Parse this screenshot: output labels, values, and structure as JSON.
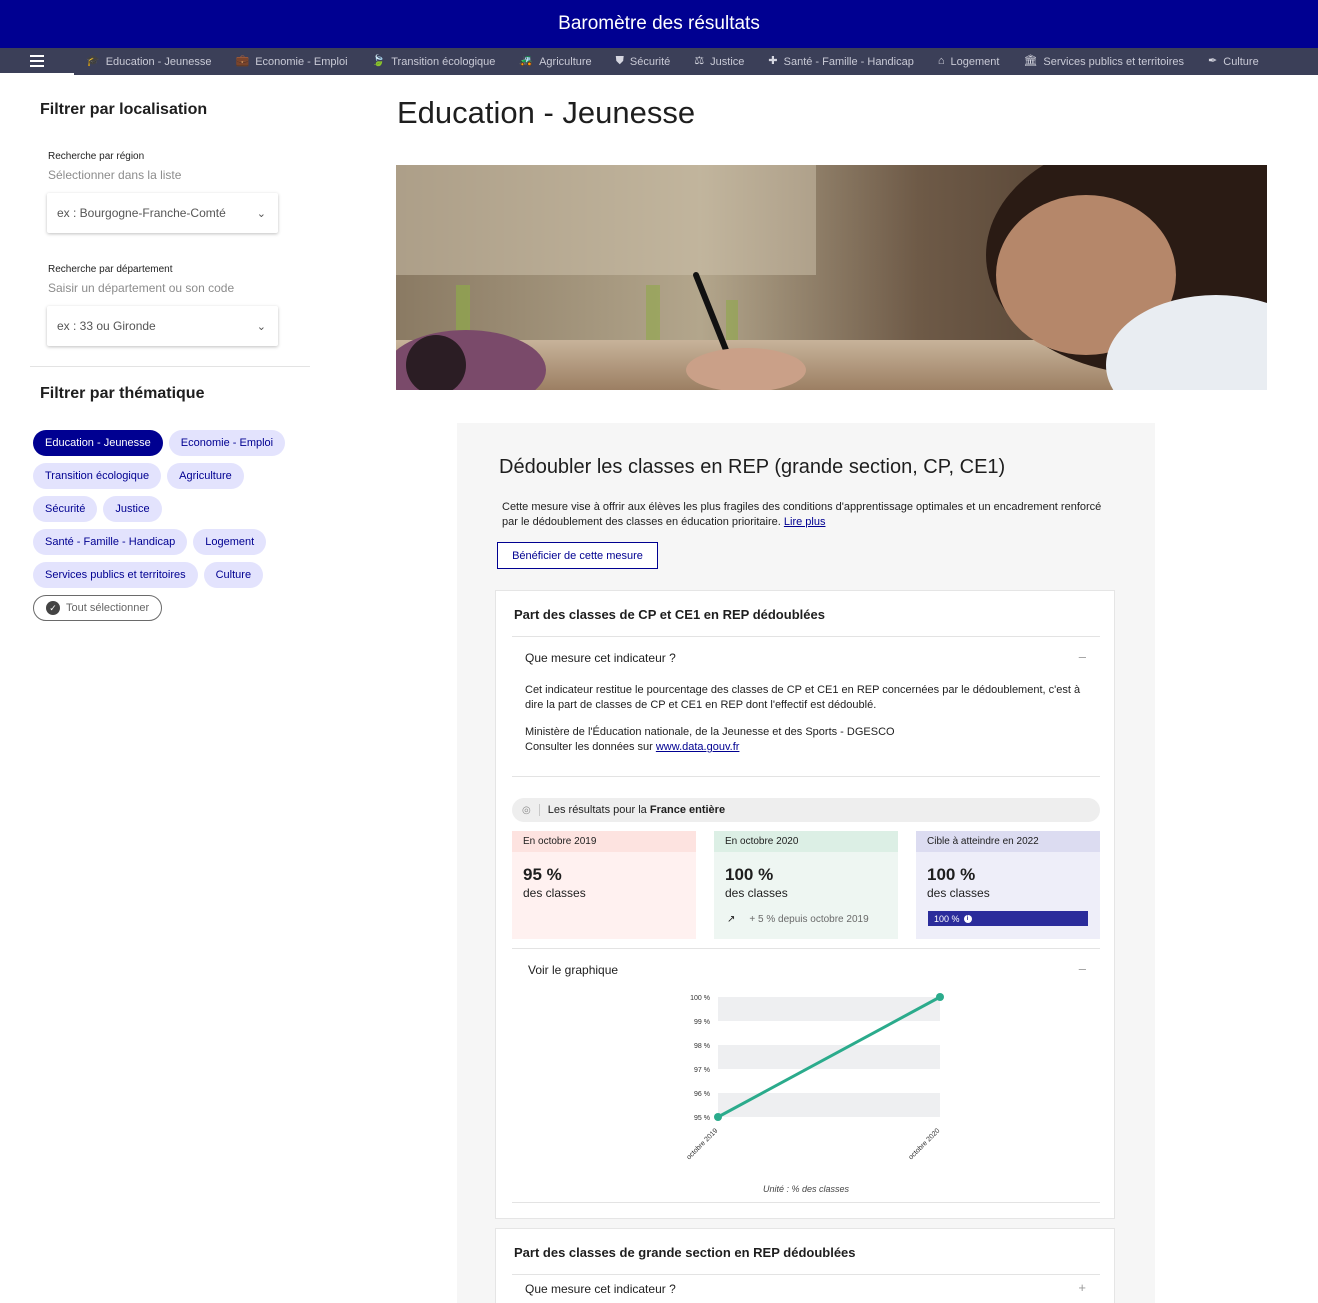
{
  "header": {
    "title": "Baromètre des résultats"
  },
  "nav": {
    "items": [
      {
        "label": "Education - Jeunesse",
        "icon": "graduation-cap-icon",
        "glyph": "🎓"
      },
      {
        "label": "Economie - Emploi",
        "icon": "briefcase-icon",
        "glyph": "💼"
      },
      {
        "label": "Transition écologique",
        "icon": "leaf-icon",
        "glyph": "🍃"
      },
      {
        "label": "Agriculture",
        "icon": "tractor-icon",
        "glyph": "🚜"
      },
      {
        "label": "Sécurité",
        "icon": "shield-icon",
        "glyph": "⛊"
      },
      {
        "label": "Justice",
        "icon": "scale-icon",
        "glyph": "⚖"
      },
      {
        "label": "Santé - Famille - Handicap",
        "icon": "medical-bag-icon",
        "glyph": "✚"
      },
      {
        "label": "Logement",
        "icon": "home-icon",
        "glyph": "⌂"
      },
      {
        "label": "Services publics et territoires",
        "icon": "institution-icon",
        "glyph": "🏛"
      },
      {
        "label": "Culture",
        "icon": "quill-icon",
        "glyph": "✒"
      }
    ]
  },
  "sidebar": {
    "location_title": "Filtrer par localisation",
    "region": {
      "label": "Recherche par région",
      "hint": "Sélectionner dans la liste",
      "placeholder": "ex : Bourgogne-Franche-Comté"
    },
    "department": {
      "label": "Recherche par département",
      "hint": "Saisir un département ou son code",
      "placeholder": "ex : 33 ou Gironde"
    },
    "theme_title": "Filtrer par thématique",
    "tags": [
      {
        "label": "Education - Jeunesse",
        "active": true
      },
      {
        "label": "Economie - Emploi",
        "active": false
      },
      {
        "label": "Transition écologique",
        "active": false
      },
      {
        "label": "Agriculture",
        "active": false
      },
      {
        "label": "Sécurité",
        "active": false
      },
      {
        "label": "Justice",
        "active": false
      },
      {
        "label": "Santé - Famille - Handicap",
        "active": false
      },
      {
        "label": "Logement",
        "active": false
      },
      {
        "label": "Services publics et territoires",
        "active": false
      },
      {
        "label": "Culture",
        "active": false
      }
    ],
    "select_all": "Tout sélectionner"
  },
  "main": {
    "title": "Education - Jeunesse",
    "measure": {
      "title": "Dédoubler les classes en REP (grande section, CP, CE1)",
      "description": "Cette mesure vise à offrir aux élèves les plus fragiles des conditions d'apprentissage optimales et un encadrement renforcé par le dédoublement des classes en éducation prioritaire.",
      "read_more": "Lire plus",
      "benefit_button": "Bénéficier de cette mesure"
    },
    "indicator1": {
      "title": "Part des classes de CP et CE1 en REP dédoublées",
      "accordion_label": "Que mesure cet indicateur ?",
      "accordion_toggle": "–",
      "body": "Cet indicateur restitue le pourcentage des classes de CP et CE1 en REP concernées par le dédoublement, c'est à dire la part de classes de CP et CE1 en REP dont l'effectif est dédoublé.",
      "source": "Ministère de l'Éducation nationale, de la Jeunesse et des Sports - DGESCO",
      "data_prefix": "Consulter les données sur",
      "data_link": "www.data.gouv.fr",
      "location_prefix": "Les résultats pour la",
      "location_value": "France entière",
      "stats": [
        {
          "head": "En octobre 2019",
          "value": "95 %",
          "unit": "des classes"
        },
        {
          "head": "En octobre 2020",
          "value": "100 %",
          "unit": "des classes",
          "delta_arrow": "↗",
          "delta": "+ 5 % depuis octobre 2019"
        },
        {
          "head": "Cible à atteindre en 2022",
          "value": "100 %",
          "unit": "des classes",
          "target": "100 %",
          "target_fill": 1.0
        }
      ],
      "chart_toggle_label": "Voir le graphique",
      "chart_toggle": "–",
      "chart_unit": "Unité : % des classes"
    },
    "indicator2": {
      "title": "Part des classes de grande section en REP dédoublées",
      "accordion_label": "Que mesure cet indicateur ?",
      "accordion_toggle": "+"
    }
  },
  "chart_data": {
    "type": "line",
    "categories": [
      "octobre 2019",
      "octobre 2020"
    ],
    "series": [
      {
        "values": [
          95,
          100
        ],
        "color": "#2bab8c"
      }
    ],
    "ylim": [
      95,
      100
    ],
    "yticks": [
      95,
      96,
      97,
      98,
      99,
      100
    ],
    "ytick_labels": [
      "95 %",
      "96 %",
      "97 %",
      "98 %",
      "99 %",
      "100 %"
    ],
    "grid": "alternating bands",
    "unit_label": "Unité : % des classes"
  }
}
